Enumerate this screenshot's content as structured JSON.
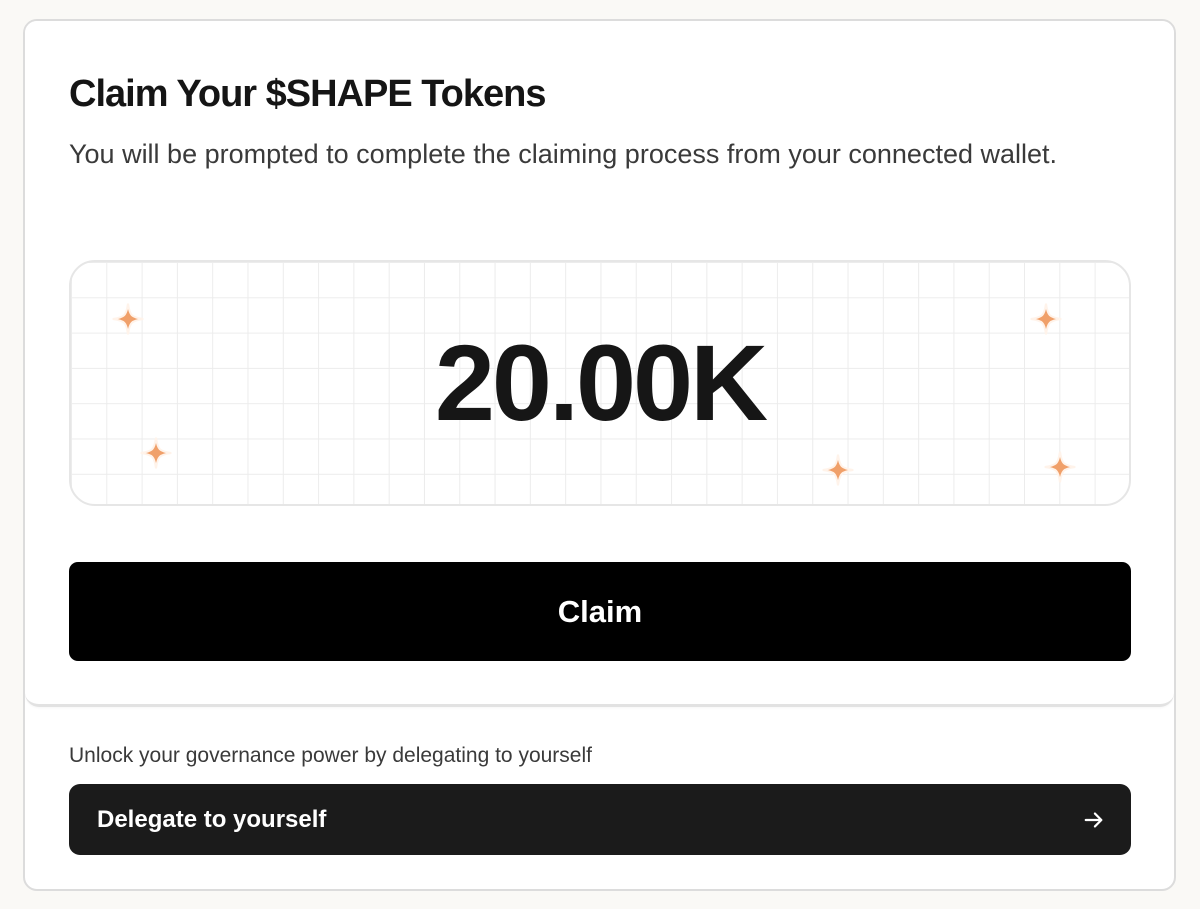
{
  "claim_card": {
    "title": "Claim Your $SHAPE Tokens",
    "subtitle": "You will be prompted to complete the claiming process from your connected wallet.",
    "amount": "20.00K",
    "claim_label": "Claim"
  },
  "delegate": {
    "prompt": "Unlock your governance power by delegating to yourself",
    "button_label": "Delegate to yourself",
    "icon": "arrow-right-icon"
  },
  "colors": {
    "accent_sparkle": "#f0a06a",
    "primary_button": "#000000",
    "secondary_button": "#1b1b1b"
  }
}
